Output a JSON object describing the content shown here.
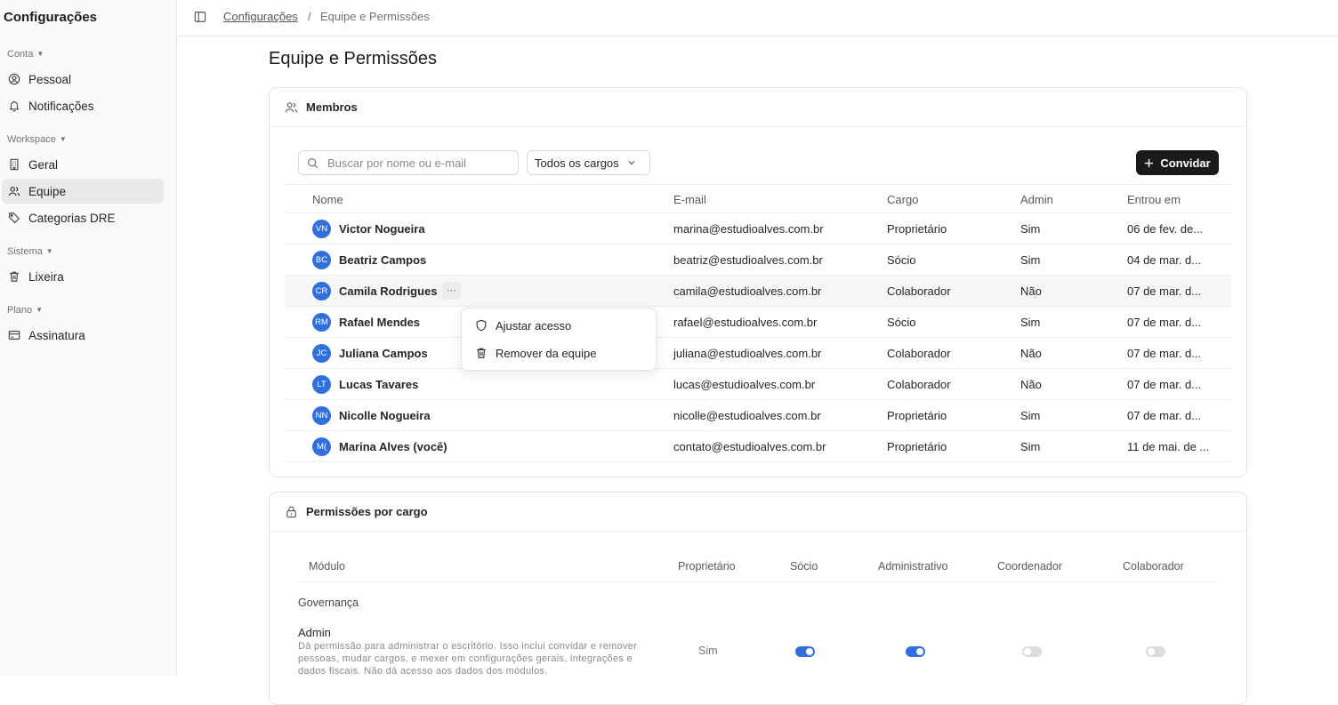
{
  "sidebar": {
    "title": "Configurações",
    "sections": [
      {
        "label": "Conta",
        "items": [
          {
            "label": "Pessoal",
            "icon": "user-circle-icon"
          },
          {
            "label": "Notificações",
            "icon": "bell-icon"
          }
        ]
      },
      {
        "label": "Workspace",
        "items": [
          {
            "label": "Geral",
            "icon": "building-icon"
          },
          {
            "label": "Equipe",
            "icon": "users-icon",
            "active": true
          },
          {
            "label": "Categorias DRE",
            "icon": "tag-icon"
          }
        ]
      },
      {
        "label": "Sistema",
        "items": [
          {
            "label": "Lixeira",
            "icon": "trash-icon"
          }
        ]
      },
      {
        "label": "Plano",
        "items": [
          {
            "label": "Assinatura",
            "icon": "credit-card-icon"
          }
        ]
      }
    ]
  },
  "breadcrumb": {
    "parent": "Configurações",
    "separator": "/",
    "current": "Equipe e Permissões"
  },
  "page_title": "Equipe e Permissões",
  "members": {
    "title": "Membros",
    "search_placeholder": "Buscar por nome ou e-mail",
    "role_filter": "Todos os cargos",
    "invite_label": "Convidar",
    "columns": {
      "name": "Nome",
      "email": "E-mail",
      "role": "Cargo",
      "admin": "Admin",
      "joined": "Entrou em"
    },
    "rows": [
      {
        "initials": "VN",
        "name": "Victor Nogueira",
        "email": "marina@estudioalves.com.br",
        "role": "Proprietário",
        "admin": "Sim",
        "joined": "06 de fev. de..."
      },
      {
        "initials": "BC",
        "name": "Beatriz Campos",
        "email": "beatriz@estudioalves.com.br",
        "role": "Sócio",
        "admin": "Sim",
        "joined": "04 de mar. d..."
      },
      {
        "initials": "CR",
        "name": "Camila Rodrigues",
        "email": "camila@estudioalves.com.br",
        "role": "Colaborador",
        "admin": "Não",
        "joined": "07 de mar. d..."
      },
      {
        "initials": "RM",
        "name": "Rafael Mendes",
        "email": "rafael@estudioalves.com.br",
        "role": "Sócio",
        "admin": "Sim",
        "joined": "07 de mar. d..."
      },
      {
        "initials": "JC",
        "name": "Juliana Campos",
        "email": "juliana@estudioalves.com.br",
        "role": "Colaborador",
        "admin": "Não",
        "joined": "07 de mar. d..."
      },
      {
        "initials": "LT",
        "name": "Lucas Tavares",
        "email": "lucas@estudioalves.com.br",
        "role": "Colaborador",
        "admin": "Não",
        "joined": "07 de mar. d..."
      },
      {
        "initials": "NN",
        "name": "Nicolle Nogueira",
        "email": "nicolle@estudioalves.com.br",
        "role": "Proprietário",
        "admin": "Sim",
        "joined": "07 de mar. d..."
      },
      {
        "initials": "M(",
        "name": "Marina Alves (você)",
        "email": "contato@estudioalves.com.br",
        "role": "Proprietário",
        "admin": "Sim",
        "joined": "11 de mai. de ..."
      }
    ],
    "more_label": "···",
    "context_menu": {
      "adjust_access": "Ajustar acesso",
      "remove_from_team": "Remover da equipe"
    }
  },
  "permissions": {
    "title": "Permissões por cargo",
    "columns": {
      "module": "Módulo",
      "owner": "Proprietário",
      "partner": "Sócio",
      "administrative": "Administrativo",
      "coordinator": "Coordenador",
      "collaborator": "Colaborador"
    },
    "group": "Governança",
    "row": {
      "title": "Admin",
      "description": "Dá permissão para administrar o escritório. Isso inclui convidar e remover pessoas, mudar cargos, e mexer em configurações gerais, integrações e dados fiscais. Não dá acesso aos dados dos módulos.",
      "owner_value": "Sim",
      "partner_on": true,
      "administrative_on": true,
      "coordinator_on": false,
      "collaborator_on": false
    }
  },
  "colors": {
    "accent": "#2f6fde",
    "dark_button": "#1a1a1a",
    "toggle_off": "#dcdcdc"
  }
}
